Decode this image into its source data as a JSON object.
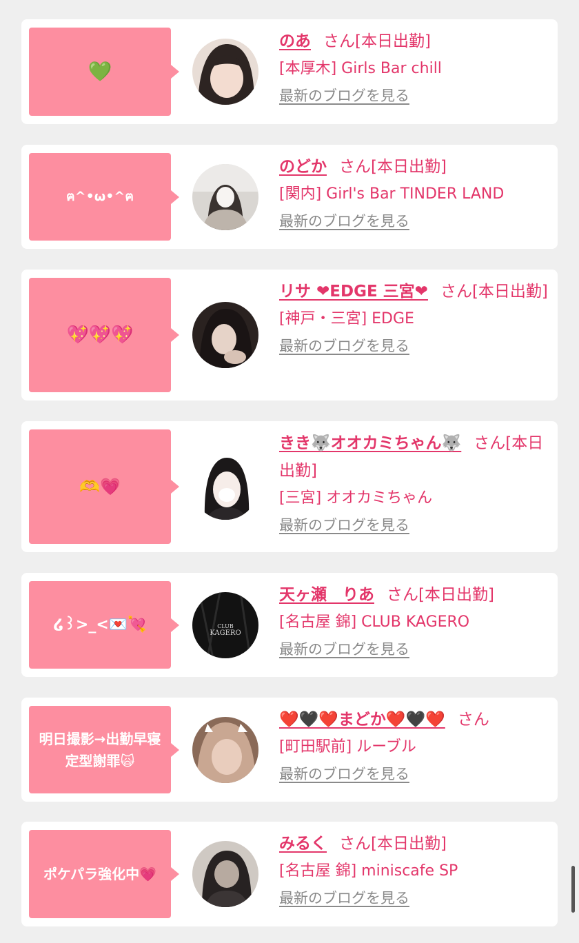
{
  "items": [
    {
      "bubble": "💚",
      "name": "のあ",
      "suffix": "さん[本日出勤]",
      "shop": "[本厚木] Girls Bar chill",
      "blog": "最新のブログを見る",
      "avatar_colors": [
        "#e6d9d2",
        "#2b2320"
      ]
    },
    {
      "bubble": "ฅ^•ω•^ฅ",
      "name": "のどか",
      "suffix": "さん[本日出勤]",
      "shop": "[関内] Girl's Bar TINDER LAND",
      "blog": "最新のブログを見る",
      "avatar_colors": [
        "#d7d4d1",
        "#3a3330"
      ]
    },
    {
      "bubble": "💖💖💖",
      "name": "リサ ❤EDGE 三宮❤",
      "suffix": "さん[本日出勤]",
      "shop": "[神戸・三宮] EDGE",
      "blog": "最新のブログを見る",
      "avatar_colors": [
        "#b8a89e",
        "#1d1716"
      ]
    },
    {
      "bubble": "🫶💗",
      "name": "きき🐺オオカミちゃん🐺",
      "suffix": "さん[本日出勤]",
      "shop": "[三宮] オオカミちゃん",
      "blog": "最新のブログを見る",
      "avatar_colors": [
        "#f4f0ee",
        "#1b1819"
      ]
    },
    {
      "bubble": "໒꒱>_<💌💘",
      "name": "天ヶ瀬　りあ",
      "suffix": "さん[本日出勤]",
      "shop": "[名古屋 錦] CLUB KAGERO",
      "blog": "最新のブログを見る",
      "avatar_colors": [
        "#161616",
        "#2a2a2a"
      ]
    },
    {
      "bubble": "明日撮影→出勤早寝定型謝罪🙀",
      "name": "❤️🖤❤️まどか❤️🖤❤️",
      "suffix": "さん",
      "shop": "[町田駅前] ルーブル",
      "blog": "最新のブログを見る",
      "avatar_colors": [
        "#c9a792",
        "#5b4538"
      ]
    },
    {
      "bubble": "ポケパラ強化中💗",
      "name": "みるく",
      "suffix": "さん[本日出勤]",
      "shop": "[名古屋 錦] miniscafe SP",
      "blog": "最新のブログを見る",
      "avatar_colors": [
        "#c8c2bc",
        "#272222"
      ]
    }
  ],
  "colors": {
    "accent": "#e3366a",
    "bubble": "#fd8ea0",
    "link_gray": "#8a8a8a",
    "background": "#efefef"
  }
}
